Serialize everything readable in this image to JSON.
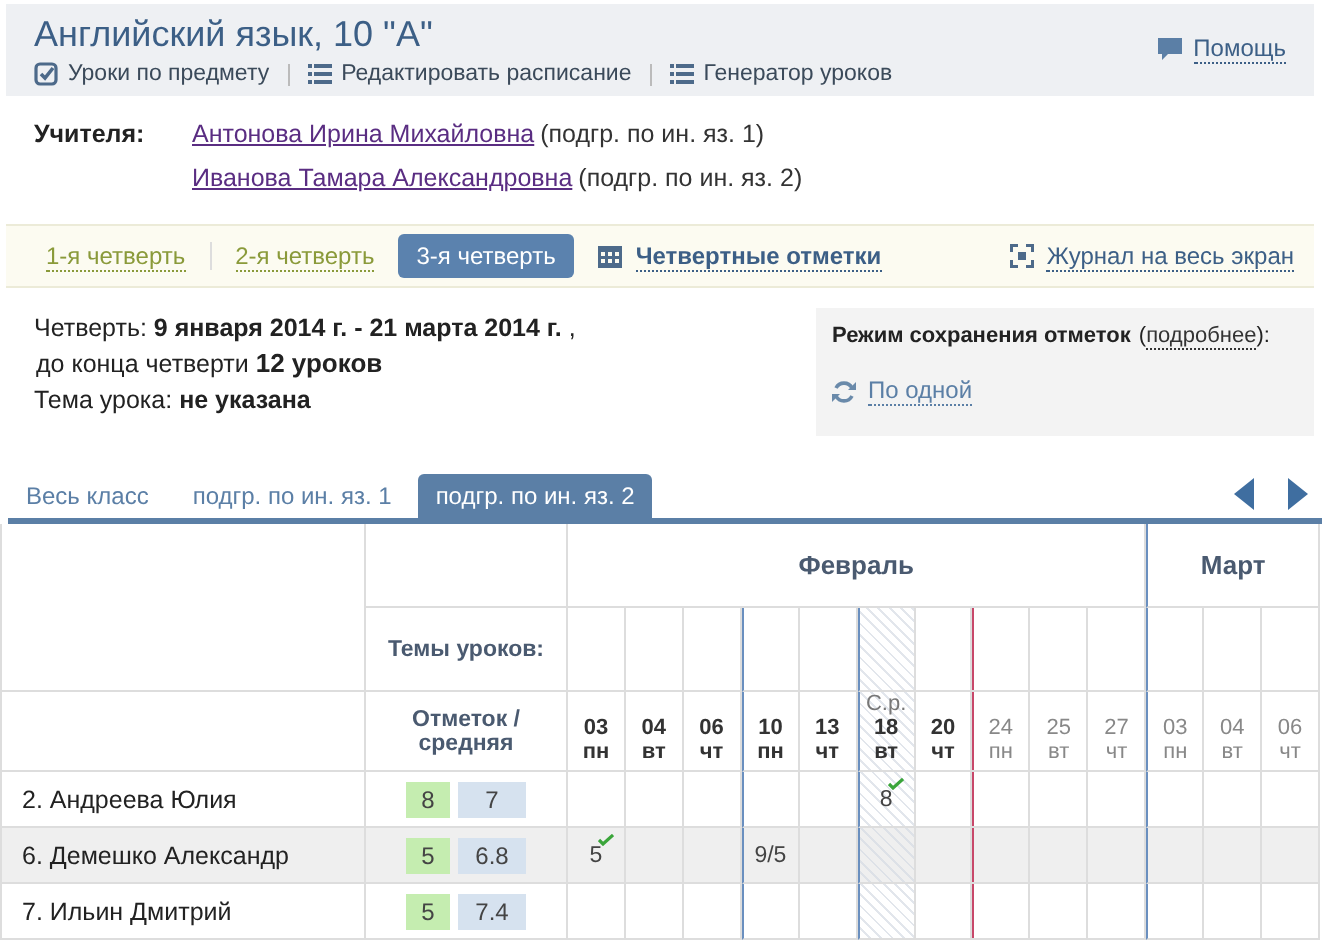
{
  "header": {
    "title": "Английский язык, 10 \"А\"",
    "links": [
      {
        "label": "Уроки по предмету",
        "kind": "check"
      },
      {
        "label": "Редактировать расписание",
        "kind": "list"
      },
      {
        "label": "Генератор уроков",
        "kind": "list"
      }
    ],
    "help": "Помощь"
  },
  "teachers": {
    "label": "Учителя:",
    "items": [
      {
        "name": "Антонова Ирина Михайловна",
        "note": "(подгр. по ин. яз. 1)"
      },
      {
        "name": "Иванова Тамара Александровна",
        "note": "(подгр. по ин. яз. 2)"
      }
    ]
  },
  "quarters": [
    {
      "label": "1-я четверть",
      "selected": false
    },
    {
      "label": "2-я четверть",
      "selected": false
    },
    {
      "label": "3-я четверть",
      "selected": true
    }
  ],
  "quarter_marks": "Четвертные отметки",
  "fullscreen": "Журнал на весь экран",
  "info": {
    "period_label": "Четверть:",
    "period": "9 января 2014 г. - 21 марта 2014 г.",
    "period_tail": ",",
    "remain_label": "до конца четверти",
    "remain": "12 уроков",
    "topic_label": "Тема урока:",
    "topic": "не указана"
  },
  "save_mode": {
    "label": "Режим сохранения отметок",
    "more": "подробнее",
    "tail": "):",
    "open": "(",
    "mode": "По одной"
  },
  "tabs": [
    {
      "label": "Весь класс",
      "selected": false
    },
    {
      "label": "подгр. по ин. яз. 1",
      "selected": false
    },
    {
      "label": "подгр. по ин. яз. 2",
      "selected": true
    }
  ],
  "journal": {
    "topics_label": "Темы уроков:",
    "stats_label": "Отметок / средняя",
    "months": [
      {
        "name": "Февраль",
        "days": [
          {
            "date": "03",
            "weekday": "пн",
            "past": true,
            "week_start": false,
            "today": false
          },
          {
            "date": "04",
            "weekday": "вт",
            "past": true,
            "week_start": false,
            "today": false
          },
          {
            "date": "06",
            "weekday": "чт",
            "past": true,
            "week_start": false,
            "today": false
          },
          {
            "date": "10",
            "weekday": "пн",
            "past": true,
            "week_start": true,
            "today": false
          },
          {
            "date": "13",
            "weekday": "чт",
            "past": true,
            "week_start": false,
            "today": false
          },
          {
            "date": "18",
            "weekday": "вт",
            "past": true,
            "week_start": true,
            "today": false,
            "test_label": "С.р."
          },
          {
            "date": "20",
            "weekday": "чт",
            "past": true,
            "week_start": false,
            "today": false
          },
          {
            "date": "24",
            "weekday": "пн",
            "past": false,
            "week_start": false,
            "today": true
          },
          {
            "date": "25",
            "weekday": "вт",
            "past": false,
            "week_start": false,
            "today": false
          },
          {
            "date": "27",
            "weekday": "чт",
            "past": false,
            "week_start": false,
            "today": false
          }
        ]
      },
      {
        "name": "Март",
        "days": [
          {
            "date": "03",
            "weekday": "пн",
            "past": false,
            "week_start": true,
            "today": false
          },
          {
            "date": "04",
            "weekday": "вт",
            "past": false,
            "week_start": false,
            "today": false
          },
          {
            "date": "06",
            "weekday": "чт",
            "past": false,
            "week_start": false,
            "today": false
          }
        ]
      }
    ],
    "students": [
      {
        "name": "2. Андреева Юлия",
        "count": "8",
        "average": "7",
        "highlighted": false,
        "cells": [
          {
            "kind": "blank"
          },
          {
            "kind": "blank"
          },
          {
            "kind": "blank"
          },
          {
            "kind": "blank"
          },
          {
            "kind": "blank"
          },
          {
            "kind": "mark",
            "value": "8",
            "checked": true
          },
          {
            "kind": "blank"
          },
          {
            "kind": "blank"
          },
          {
            "kind": "blank"
          },
          {
            "kind": "blank"
          },
          {
            "kind": "blank"
          },
          {
            "kind": "blank"
          },
          {
            "kind": "blank"
          }
        ]
      },
      {
        "name": "6. Демешко Александр",
        "count": "5",
        "average": "6.8",
        "highlighted": true,
        "cells": [
          {
            "kind": "mark",
            "value": "5",
            "checked": true
          },
          {
            "kind": "blank"
          },
          {
            "kind": "blank"
          },
          {
            "kind": "mark",
            "value": "9/5",
            "checked": false
          },
          {
            "kind": "blank"
          },
          {
            "kind": "blank"
          },
          {
            "kind": "blank"
          },
          {
            "kind": "blank"
          },
          {
            "kind": "blank"
          },
          {
            "kind": "blank"
          },
          {
            "kind": "blank"
          },
          {
            "kind": "blank"
          },
          {
            "kind": "blank"
          }
        ]
      },
      {
        "name": "7. Ильин Дмитрий",
        "count": "5",
        "average": "7.4",
        "highlighted": false
      }
    ]
  }
}
